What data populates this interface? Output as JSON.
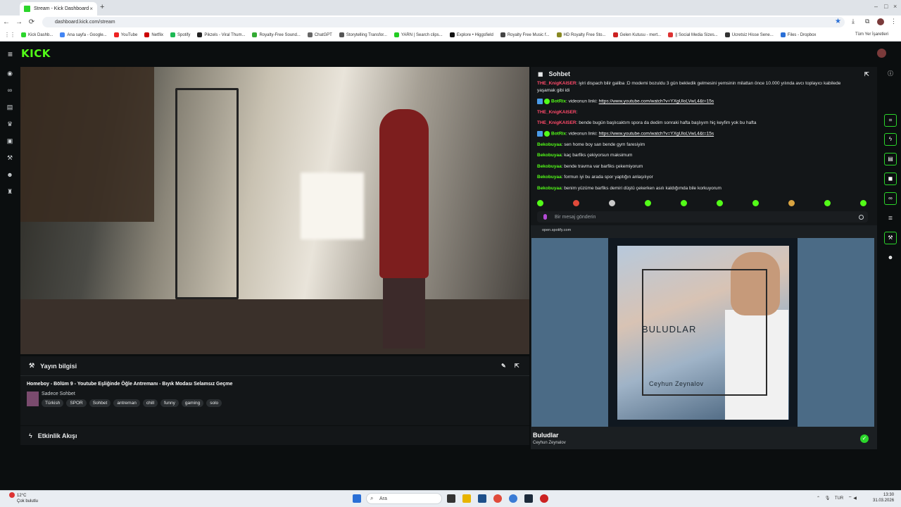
{
  "browser": {
    "tab_title": "Stream - Kick Dashboard",
    "url": "dashboard.kick.com/stream",
    "bookmarks": [
      "Kick Dashb...",
      "Ana sayfa - Google...",
      "YouTube",
      "Netflix",
      "Spotify",
      "Pikzels - Viral Thum...",
      "Royalty-Free Sound...",
      "ChatGPT",
      "Storytelling Transfor...",
      "YARN | Search clips...",
      "Explore • Higgsfield",
      "Royalty Free Music f...",
      "HD Royalty Free Sto...",
      "Gelen Kutusu - mert...",
      "|| Social Media Sizes...",
      "Ücretsiz Hisse Sene...",
      "Files - Dropbox"
    ],
    "all_bookmarks": "Tüm Yer İşaretleri"
  },
  "kick": {
    "logo": "KICK",
    "stream_info": {
      "heading": "Yayın bilgisi",
      "title": "Homeboy - Bölüm 9 - Youtube Eşliğinde Öğle Antremanı - Bıyık Modası Selamsız Geçme",
      "category": "Sadece Sohbet",
      "tags": [
        "Türkish",
        "SPOR",
        "Sohbet",
        "antreman",
        "chill",
        "funny",
        "gaming",
        "solo"
      ]
    },
    "activity": {
      "heading": "Etkinlik Akışı"
    },
    "chat": {
      "heading": "Sohbet",
      "input_placeholder": "Bir mesaj gönderin",
      "messages": [
        {
          "user": "THE_KnigKAISER",
          "text": ": iyiri dispach bilir galiba :D modemi bozuldu 3 gün bekledik gelmesini yemsinin milattan önce 10.000 yılında avcı toplayıcı kabilede"
        },
        {
          "user": "",
          "text": "yaşamak gibi idi"
        },
        {
          "user": "BotRix",
          "text": ": videonun linki: ",
          "link": "https://www.youtube.com/watch?v=YXgUloLVwL4&t=15s"
        },
        {
          "user": "THE_KnigKAISER",
          "text": ": "
        },
        {
          "user": "THE_KnigKAISER",
          "text": ": bende bugün başlıcaktım spora da dedim sonraki hafta başlıyım hiç keyfim yok bu hafta"
        },
        {
          "user": "BotRix",
          "text": ": videonun linki: ",
          "link": "https://www.youtube.com/watch?v=YXgUloLVwL4&t=15s"
        },
        {
          "user": "Bekobuyaa",
          "text": ": sen home boy san bende gym faresiyim"
        },
        {
          "user": "Bekobuyaa",
          "text": ": kaç barfiks çekiyorsun maksimum"
        },
        {
          "user": "Bekobuyaa",
          "text": ": bende travma var barfiks çekemiyorum"
        },
        {
          "user": "Bekobuyaa",
          "text": ": formun iyi bu arada spor yaptığın anlaşılıyor"
        },
        {
          "user": "Bekobuyaa",
          "text": ": benim yüzüme barfiks demiri düştü çekerken asılı kaldığımda bile korkuyorum"
        }
      ]
    },
    "spotify": {
      "source": "open.spotify.com",
      "song": "Buludlar",
      "artist": "Ceyhun Zeynalov",
      "cover_title": "BULUDLAR",
      "cover_artist": "Ceyhun Zeynalov"
    }
  },
  "taskbar": {
    "weather_temp": "12°C",
    "weather_desc": "Çok bulutlu",
    "search": "Ara",
    "lang": "TUR",
    "time": "13:30",
    "date": "31.03.2026"
  },
  "colors": {
    "accent": "#53fc18",
    "bg": "#0b0e0f",
    "panel": "#131618"
  }
}
